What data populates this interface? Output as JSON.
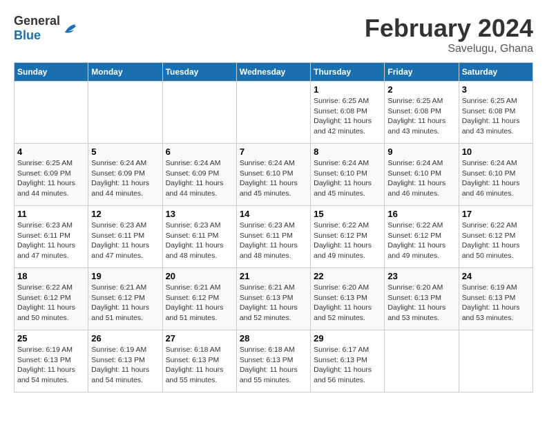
{
  "header": {
    "logo_general": "General",
    "logo_blue": "Blue",
    "month_title": "February 2024",
    "subtitle": "Savelugu, Ghana"
  },
  "days_of_week": [
    "Sunday",
    "Monday",
    "Tuesday",
    "Wednesday",
    "Thursday",
    "Friday",
    "Saturday"
  ],
  "weeks": [
    [
      {
        "day": "",
        "info": ""
      },
      {
        "day": "",
        "info": ""
      },
      {
        "day": "",
        "info": ""
      },
      {
        "day": "",
        "info": ""
      },
      {
        "day": "1",
        "info": "Sunrise: 6:25 AM\nSunset: 6:08 PM\nDaylight: 11 hours\nand 42 minutes."
      },
      {
        "day": "2",
        "info": "Sunrise: 6:25 AM\nSunset: 6:08 PM\nDaylight: 11 hours\nand 43 minutes."
      },
      {
        "day": "3",
        "info": "Sunrise: 6:25 AM\nSunset: 6:08 PM\nDaylight: 11 hours\nand 43 minutes."
      }
    ],
    [
      {
        "day": "4",
        "info": "Sunrise: 6:25 AM\nSunset: 6:09 PM\nDaylight: 11 hours\nand 44 minutes."
      },
      {
        "day": "5",
        "info": "Sunrise: 6:24 AM\nSunset: 6:09 PM\nDaylight: 11 hours\nand 44 minutes."
      },
      {
        "day": "6",
        "info": "Sunrise: 6:24 AM\nSunset: 6:09 PM\nDaylight: 11 hours\nand 44 minutes."
      },
      {
        "day": "7",
        "info": "Sunrise: 6:24 AM\nSunset: 6:10 PM\nDaylight: 11 hours\nand 45 minutes."
      },
      {
        "day": "8",
        "info": "Sunrise: 6:24 AM\nSunset: 6:10 PM\nDaylight: 11 hours\nand 45 minutes."
      },
      {
        "day": "9",
        "info": "Sunrise: 6:24 AM\nSunset: 6:10 PM\nDaylight: 11 hours\nand 46 minutes."
      },
      {
        "day": "10",
        "info": "Sunrise: 6:24 AM\nSunset: 6:10 PM\nDaylight: 11 hours\nand 46 minutes."
      }
    ],
    [
      {
        "day": "11",
        "info": "Sunrise: 6:23 AM\nSunset: 6:11 PM\nDaylight: 11 hours\nand 47 minutes."
      },
      {
        "day": "12",
        "info": "Sunrise: 6:23 AM\nSunset: 6:11 PM\nDaylight: 11 hours\nand 47 minutes."
      },
      {
        "day": "13",
        "info": "Sunrise: 6:23 AM\nSunset: 6:11 PM\nDaylight: 11 hours\nand 48 minutes."
      },
      {
        "day": "14",
        "info": "Sunrise: 6:23 AM\nSunset: 6:11 PM\nDaylight: 11 hours\nand 48 minutes."
      },
      {
        "day": "15",
        "info": "Sunrise: 6:22 AM\nSunset: 6:12 PM\nDaylight: 11 hours\nand 49 minutes."
      },
      {
        "day": "16",
        "info": "Sunrise: 6:22 AM\nSunset: 6:12 PM\nDaylight: 11 hours\nand 49 minutes."
      },
      {
        "day": "17",
        "info": "Sunrise: 6:22 AM\nSunset: 6:12 PM\nDaylight: 11 hours\nand 50 minutes."
      }
    ],
    [
      {
        "day": "18",
        "info": "Sunrise: 6:22 AM\nSunset: 6:12 PM\nDaylight: 11 hours\nand 50 minutes."
      },
      {
        "day": "19",
        "info": "Sunrise: 6:21 AM\nSunset: 6:12 PM\nDaylight: 11 hours\nand 51 minutes."
      },
      {
        "day": "20",
        "info": "Sunrise: 6:21 AM\nSunset: 6:12 PM\nDaylight: 11 hours\nand 51 minutes."
      },
      {
        "day": "21",
        "info": "Sunrise: 6:21 AM\nSunset: 6:13 PM\nDaylight: 11 hours\nand 52 minutes."
      },
      {
        "day": "22",
        "info": "Sunrise: 6:20 AM\nSunset: 6:13 PM\nDaylight: 11 hours\nand 52 minutes."
      },
      {
        "day": "23",
        "info": "Sunrise: 6:20 AM\nSunset: 6:13 PM\nDaylight: 11 hours\nand 53 minutes."
      },
      {
        "day": "24",
        "info": "Sunrise: 6:19 AM\nSunset: 6:13 PM\nDaylight: 11 hours\nand 53 minutes."
      }
    ],
    [
      {
        "day": "25",
        "info": "Sunrise: 6:19 AM\nSunset: 6:13 PM\nDaylight: 11 hours\nand 54 minutes."
      },
      {
        "day": "26",
        "info": "Sunrise: 6:19 AM\nSunset: 6:13 PM\nDaylight: 11 hours\nand 54 minutes."
      },
      {
        "day": "27",
        "info": "Sunrise: 6:18 AM\nSunset: 6:13 PM\nDaylight: 11 hours\nand 55 minutes."
      },
      {
        "day": "28",
        "info": "Sunrise: 6:18 AM\nSunset: 6:13 PM\nDaylight: 11 hours\nand 55 minutes."
      },
      {
        "day": "29",
        "info": "Sunrise: 6:17 AM\nSunset: 6:13 PM\nDaylight: 11 hours\nand 56 minutes."
      },
      {
        "day": "",
        "info": ""
      },
      {
        "day": "",
        "info": ""
      }
    ]
  ]
}
